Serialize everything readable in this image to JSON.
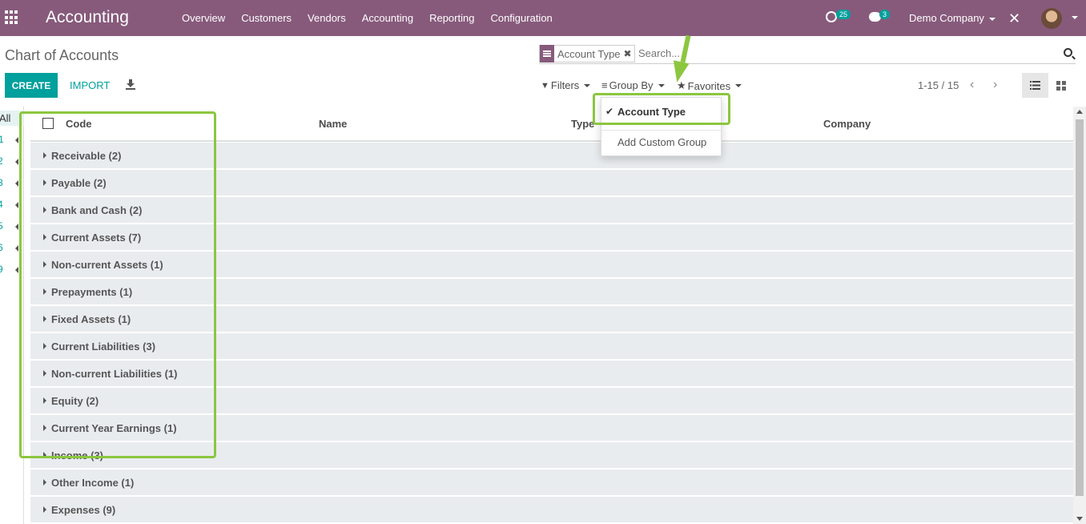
{
  "navbar": {
    "app_title": "Accounting",
    "menu": [
      "Overview",
      "Customers",
      "Vendors",
      "Accounting",
      "Reporting",
      "Configuration"
    ],
    "activity_count": "25",
    "message_count": "3",
    "company": "Demo Company",
    "debug_glyph": "✕"
  },
  "breadcrumb": "Chart of Accounts",
  "search": {
    "facet_label": "Account Type",
    "facet_remove": "✖",
    "placeholder": "Search..."
  },
  "actions": {
    "create": "CREATE",
    "import": "IMPORT"
  },
  "filters": {
    "filters_label": "Filters",
    "group_by_label": "Group By",
    "favorites_label": "Favorites"
  },
  "group_by_menu": {
    "selected": "Account Type",
    "add_custom": "Add Custom Group"
  },
  "pager": {
    "range": "1-15 / 15",
    "prev": "‹",
    "next": "›"
  },
  "left_panel": {
    "all_label": "All",
    "items": [
      "1",
      "2",
      "3",
      "4",
      "5",
      "6",
      "9"
    ]
  },
  "table": {
    "columns": [
      "Code",
      "Name",
      "Type",
      "Company"
    ],
    "groups": [
      "Receivable (2)",
      "Payable (2)",
      "Bank and Cash (2)",
      "Current Assets (7)",
      "Non-current Assets (1)",
      "Prepayments (1)",
      "Fixed Assets (1)",
      "Current Liabilities (3)",
      "Non-current Liabilities (1)",
      "Equity (2)",
      "Current Year Earnings (1)",
      "Income (3)",
      "Other Income (1)",
      "Expenses (9)"
    ]
  },
  "colors": {
    "brand": "#875a7b",
    "accent": "#00a09d",
    "annotation": "#8cc63f",
    "group_row": "#e9ecef"
  }
}
